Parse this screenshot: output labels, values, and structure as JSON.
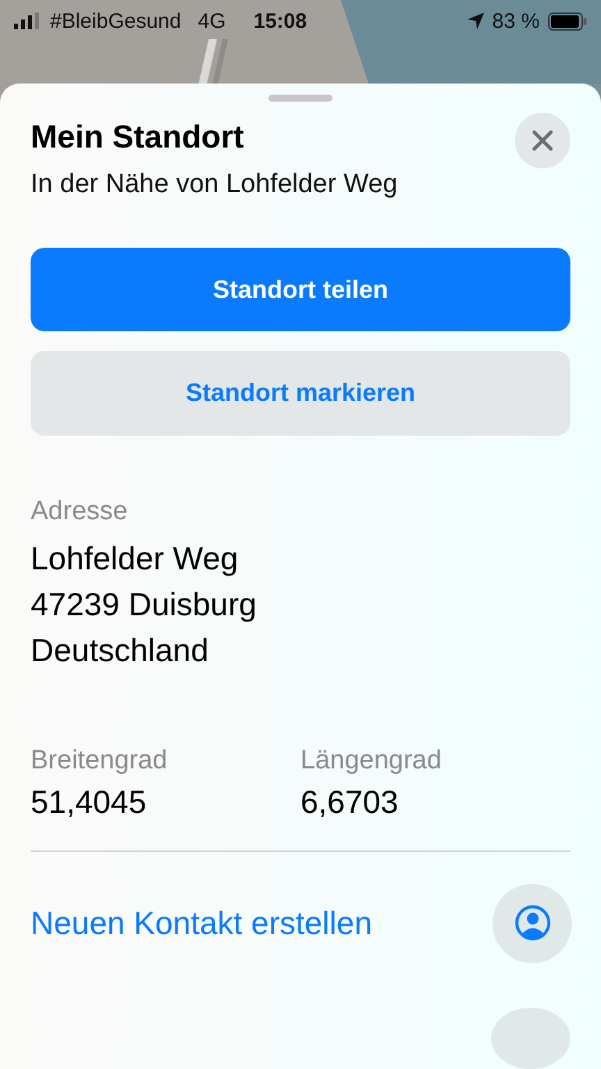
{
  "status_bar": {
    "carrier": "#BleibGesund",
    "network": "4G",
    "time": "15:08",
    "battery": "83 %"
  },
  "sheet": {
    "title": "Mein Standort",
    "subtitle": "In der Nähe von Lohfelder Weg",
    "buttons": [
      {
        "label": "Standort teilen",
        "kind": "primary"
      },
      {
        "label": "Standort markieren",
        "kind": "secondary"
      }
    ],
    "address": {
      "label": "Adresse",
      "lines": [
        "Lohfelder Weg",
        "47239 Duisburg",
        "Deutschland"
      ]
    },
    "coordinates": [
      {
        "label": "Breitengrad",
        "value": "51,4045"
      },
      {
        "label": "Längengrad",
        "value": "6,6703"
      }
    ],
    "actions": [
      {
        "label": "Neuen Kontakt erstellen",
        "kind": "contact"
      }
    ]
  }
}
